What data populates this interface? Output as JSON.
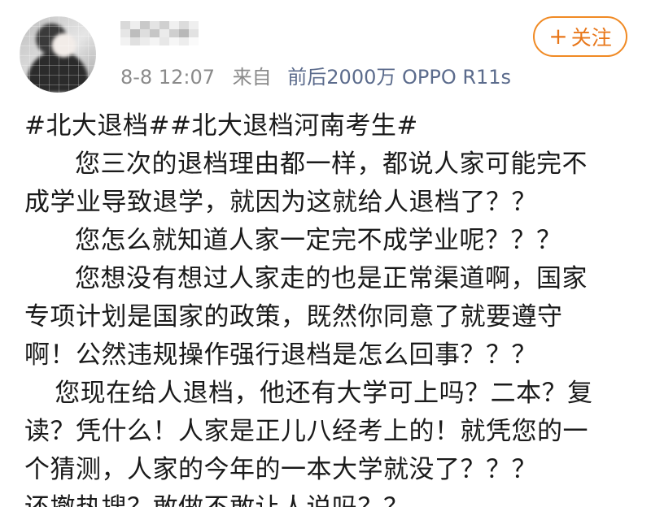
{
  "post": {
    "timestamp": "8-8 12:07",
    "from_label": "来自",
    "source": "前后2000万 OPPO R11s",
    "follow_label": "关注",
    "follow_icon": "plus-icon",
    "colors": {
      "accent": "#e8771a",
      "source_link": "#5b6b8c",
      "meta_gray": "#8a8a8a"
    },
    "lines": [
      "#北大退档##北大退档河南考生#",
      "您三次的退档理由都一样，都说人家可能完不",
      "成学业导致退学，就因为这就给人退档了？？",
      "您怎么就知道人家一定完不成学业呢？？？",
      "您想没有想过人家走的也是正常渠道啊，国家",
      "专项计划是国家的政策，既然你同意了就要遵守",
      "啊！公然违规操作强行退档是怎么回事？？？",
      "您现在给人退档，他还有大学可上吗？二本？复",
      "读？凭什么！人家是正儿八经考上的！就凭您的一",
      "个猜测，人家的今年的一本大学就没了？？？",
      "还撤热搜？敢做不敢让人说吗？？"
    ]
  }
}
